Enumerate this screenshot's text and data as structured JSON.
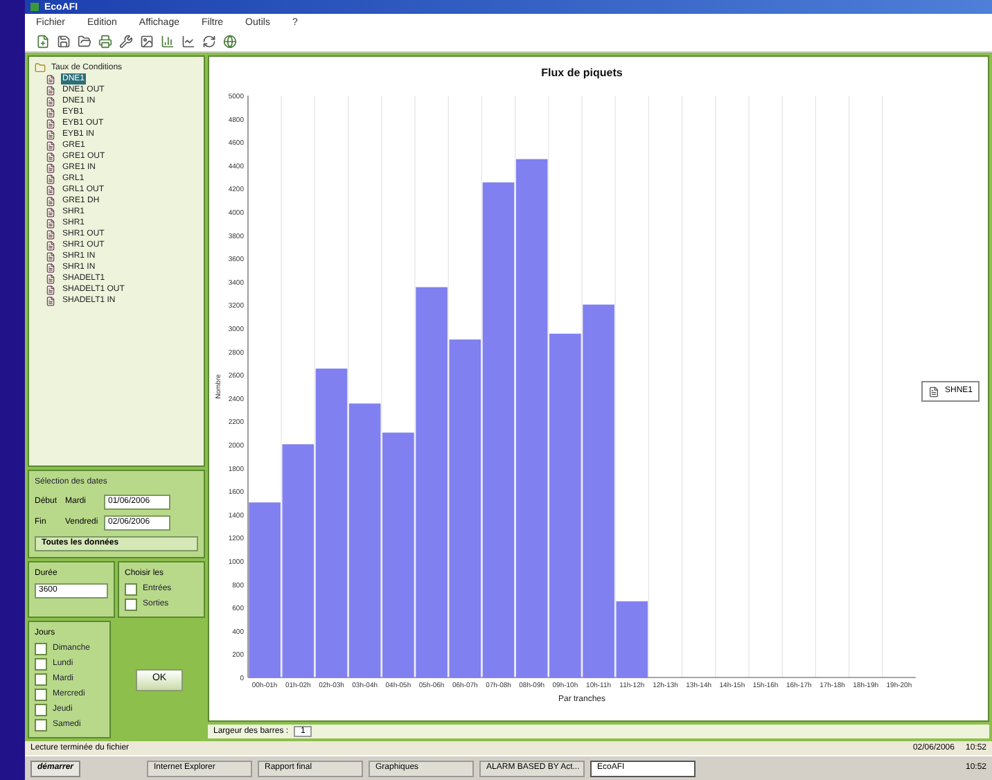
{
  "window": {
    "title": "EcoAFI"
  },
  "menu": [
    "Fichier",
    "Edition",
    "Affichage",
    "Filtre",
    "Outils",
    "?"
  ],
  "tree": {
    "label": "Taux de Conditions",
    "expanded": true,
    "children": [
      {
        "label": "DNE1",
        "selected": true
      },
      {
        "label": "DNE1 OUT",
        "selected": false
      },
      {
        "label": "DNE1 IN",
        "selected": false
      },
      {
        "label": "EYB1",
        "selected": false
      },
      {
        "label": "EYB1 OUT",
        "selected": false
      },
      {
        "label": "EYB1 IN",
        "selected": false
      },
      {
        "label": "GRE1",
        "selected": false
      },
      {
        "label": "GRE1 OUT",
        "selected": false
      },
      {
        "label": "GRE1 IN",
        "selected": false
      },
      {
        "label": "GRL1",
        "selected": false
      },
      {
        "label": "GRL1 OUT",
        "selected": false
      },
      {
        "label": "GRE1 DH",
        "selected": false
      },
      {
        "label": "SHR1",
        "selected": false
      },
      {
        "label": "SHR1",
        "selected": false
      },
      {
        "label": "SHR1 OUT",
        "selected": false
      },
      {
        "label": "SHR1 OUT",
        "selected": false
      },
      {
        "label": "SHR1 IN",
        "selected": false
      },
      {
        "label": "SHR1 IN",
        "selected": false
      },
      {
        "label": "SHADELT1",
        "selected": false
      },
      {
        "label": "SHADELT1 OUT",
        "selected": false
      },
      {
        "label": "SHADELT1 IN",
        "selected": false
      }
    ]
  },
  "dates": {
    "title": "Sélection des dates",
    "start_label": "Début",
    "start_day": "Mardi",
    "start_date": "01/06/2006",
    "end_label": "Fin",
    "end_day": "Vendredi",
    "end_date": "02/06/2006",
    "range": "Toutes les données"
  },
  "duration": {
    "title": "Durée",
    "value": "3600"
  },
  "direction": {
    "title": "Choisir les",
    "options": [
      {
        "label": "Entrées",
        "checked": false
      },
      {
        "label": "Sorties",
        "checked": false
      }
    ]
  },
  "days": {
    "title": "Jours",
    "options": [
      {
        "label": "Dimanche",
        "checked": false
      },
      {
        "label": "Lundi",
        "checked": false
      },
      {
        "label": "Mardi",
        "checked": false
      },
      {
        "label": "Mercredi",
        "checked": false
      },
      {
        "label": "Jeudi",
        "checked": false
      },
      {
        "label": "Samedi",
        "checked": false
      }
    ]
  },
  "ok_button": "OK",
  "chart": {
    "footer_label": "Largeur des barres :",
    "footer_value": "1",
    "chart_data": {
      "type": "bar",
      "title": "Flux de piquets",
      "xlabel": "Par tranches",
      "ylabel": "Nombre",
      "categories": [
        "00h-01h",
        "01h-02h",
        "02h-03h",
        "03h-04h",
        "04h-05h",
        "05h-06h",
        "06h-07h",
        "07h-08h",
        "08h-09h",
        "09h-10h",
        "10h-11h",
        "11h-12h",
        "12h-13h",
        "13h-14h",
        "14h-15h",
        "15h-16h",
        "16h-17h",
        "17h-18h",
        "18h-19h",
        "19h-20h"
      ],
      "series": [
        {
          "name": "SHNE1",
          "color": "#8080f0",
          "values": [
            1500,
            2000,
            2650,
            2350,
            2100,
            3350,
            2900,
            4250,
            4450,
            2950,
            3200,
            650,
            0,
            0,
            0,
            0,
            0,
            0,
            0,
            0
          ]
        }
      ],
      "ylim": [
        0,
        5000
      ],
      "yticks": [
        0,
        200,
        400,
        600,
        800,
        1000,
        1200,
        1400,
        1600,
        1800,
        2000,
        2200,
        2400,
        2600,
        2800,
        3000,
        3200,
        3400,
        3600,
        3800,
        4000,
        4200,
        4400,
        4600,
        4800,
        5000
      ]
    }
  },
  "status_bar": {
    "text": "Lecture terminée du fichier",
    "date": "02/06/2006",
    "time": "10:52"
  },
  "taskbar": {
    "start": "démarrer",
    "tasks": [
      {
        "label": "Internet Explorer",
        "selected": false
      },
      {
        "label": "Rapport final",
        "selected": false
      },
      {
        "label": "Graphiques",
        "selected": false
      },
      {
        "label": "ALARM BASED BY Act...",
        "selected": false
      },
      {
        "label": "EcoAFI",
        "selected": true
      }
    ],
    "clock": "10:52"
  }
}
